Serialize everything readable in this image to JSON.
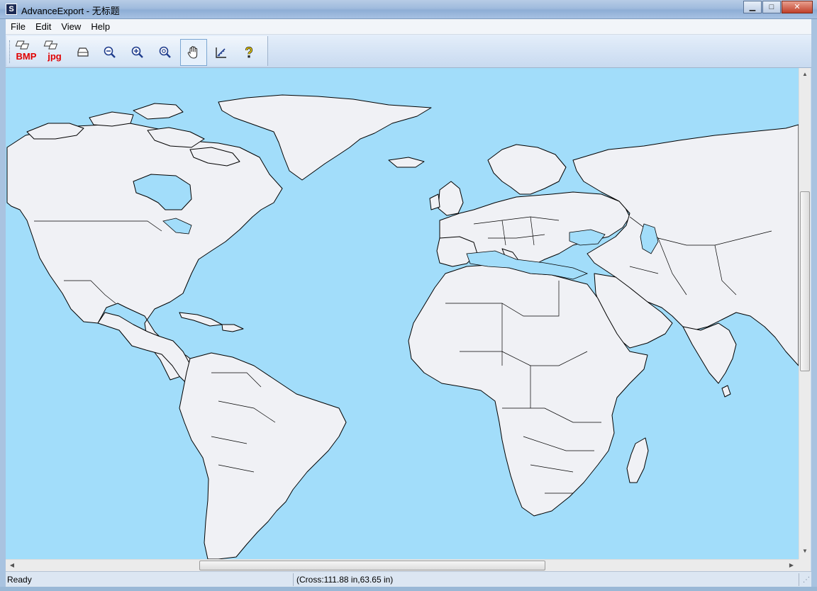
{
  "window": {
    "title": "AdvanceExport - 无标题",
    "minimize_glyph": "▁",
    "maximize_glyph": "□",
    "close_glyph": "✕"
  },
  "menu": {
    "items": [
      {
        "label": "File"
      },
      {
        "label": "Edit"
      },
      {
        "label": "View"
      },
      {
        "label": "Help"
      }
    ]
  },
  "toolbar": {
    "buttons": [
      {
        "name": "export-bmp-icon",
        "label": "BMP"
      },
      {
        "name": "export-jpg-icon",
        "label": "jpg"
      },
      {
        "name": "print-icon"
      },
      {
        "name": "zoom-out-icon"
      },
      {
        "name": "zoom-in-icon"
      },
      {
        "name": "zoom-extent-icon"
      },
      {
        "name": "pan-hand-icon",
        "active": true
      },
      {
        "name": "measure-icon"
      },
      {
        "name": "help-icon"
      }
    ]
  },
  "colors": {
    "ocean": "#a2ddfa",
    "land": "#f0f1f5",
    "border": "#000000",
    "export_label": "#e00000"
  },
  "statusbar": {
    "ready": "Ready",
    "coords": "(Cross:111.88 in,63.65 in)"
  }
}
